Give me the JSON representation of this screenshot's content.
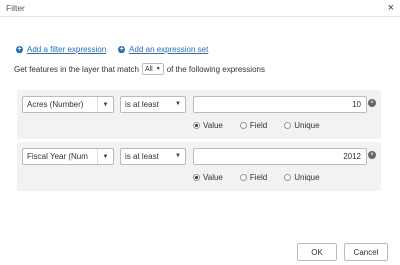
{
  "dialog": {
    "title": "Filter",
    "close_symbol": "×"
  },
  "links": {
    "add_filter_expression": "Add a filter expression",
    "add_expression_set": "Add an expression set"
  },
  "match": {
    "prefix": "Get features in the layer that match",
    "selected": "All",
    "suffix": "of the following expressions"
  },
  "expressions": [
    {
      "field": "Acres (Number)",
      "operator": "is at least",
      "value": "10",
      "radio_options": [
        "Value",
        "Field",
        "Unique"
      ],
      "selected_radio": "Value"
    },
    {
      "field": "Fiscal Year (Num",
      "operator": "is at least",
      "value": "2012",
      "radio_options": [
        "Value",
        "Field",
        "Unique"
      ],
      "selected_radio": "Value"
    }
  ],
  "buttons": {
    "ok": "OK",
    "cancel": "Cancel"
  },
  "colors": {
    "link": "#2b6cb5",
    "panel_bg": "#f2f2f2"
  }
}
